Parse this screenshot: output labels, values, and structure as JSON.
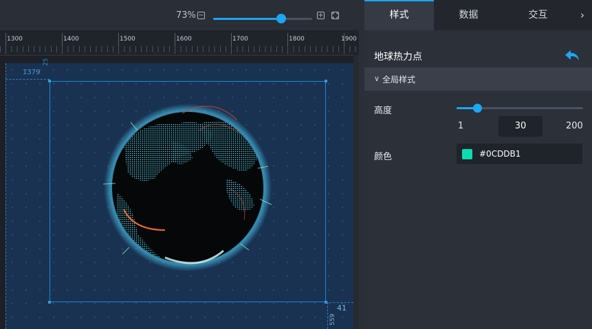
{
  "toolbar": {
    "zoom_percent": "73%",
    "zoom_slider_value": 0.73,
    "zoom_out_symbol": "−",
    "zoom_in_symbol": "+",
    "zoom_out_icon": "minus-square-icon",
    "zoom_in_icon": "plus-square-icon",
    "fit_icon": "fit-screen-icon"
  },
  "ruler": {
    "ticks": [
      "1300",
      "1400",
      "1500",
      "1600",
      "1700",
      "1800",
      "1900"
    ],
    "vertical_top_label": "25",
    "left_offset_label": "1379"
  },
  "canvas": {
    "width_label": "41",
    "height_label": "559",
    "globe": {
      "name": "globe-heatmap-preview"
    }
  },
  "tabs": [
    {
      "label": "样式",
      "active": true
    },
    {
      "label": "数据",
      "active": false
    },
    {
      "label": "交互",
      "active": false
    }
  ],
  "tabs_more": "›",
  "panel": {
    "title": "地球热力点",
    "undo_icon": "undo-arrow-icon",
    "section_label": "全局样式",
    "section_chevron": "∨",
    "height": {
      "label": "高度",
      "min": "1",
      "value": "30",
      "max": "200"
    },
    "color": {
      "label": "颜色",
      "hex": "#0CDDB1",
      "swatch": "#0CDDB1"
    }
  },
  "colors": {
    "accent": "#1aa8f2",
    "artboard": "#193252"
  }
}
